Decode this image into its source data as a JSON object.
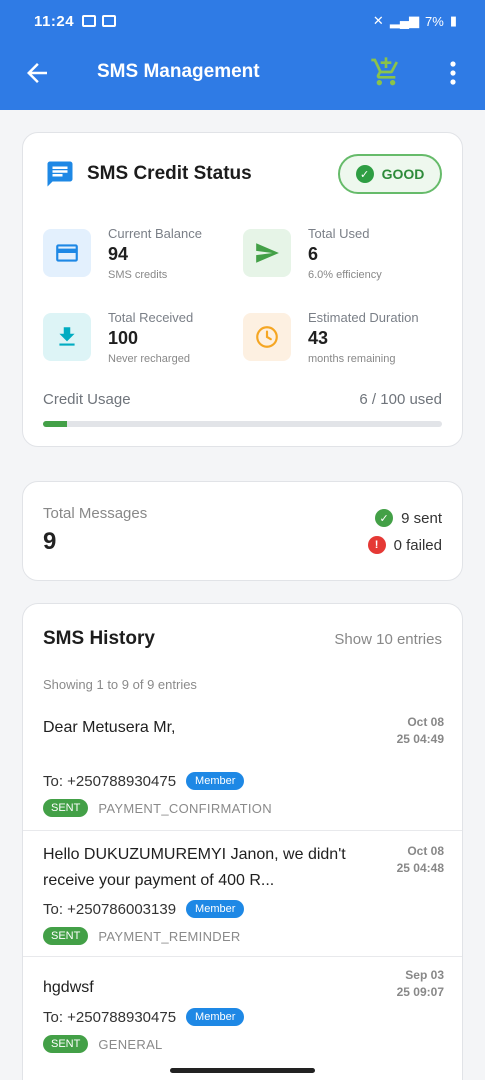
{
  "status_bar": {
    "time": "11:24",
    "battery": "7%"
  },
  "header": {
    "title": "SMS Management"
  },
  "credit": {
    "title": "SMS Credit Status",
    "status": "GOOD",
    "stats": [
      {
        "label": "Current Balance",
        "value": "94",
        "sub": "SMS credits"
      },
      {
        "label": "Total Used",
        "value": "6",
        "sub": "6.0% efficiency"
      },
      {
        "label": "Total Received",
        "value": "100",
        "sub": "Never recharged"
      },
      {
        "label": "Estimated Duration",
        "value": "43",
        "sub": "months remaining"
      }
    ],
    "usage_label": "Credit Usage",
    "usage_value": "6 / 100 used",
    "usage_fraction": 0.06
  },
  "totals": {
    "label": "Total Messages",
    "value": "9",
    "sent": "9 sent",
    "failed": "0 failed"
  },
  "history": {
    "title": "SMS History",
    "show": "Show 10 entries",
    "info": "Showing 1 to 9 of 9 entries",
    "entries": [
      {
        "message": "Dear Metusera Mr,",
        "date_line1": "Oct 08",
        "date_line2": "25 04:49",
        "to": "To: +250788930475",
        "role": "Member",
        "status": "SENT",
        "type": "PAYMENT_CONFIRMATION"
      },
      {
        "message": "Hello DUKUZUMUREMYI Janon, we didn't receive your payment of 400 R...",
        "date_line1": "Oct 08",
        "date_line2": "25 04:48",
        "to": "To: +250786003139",
        "role": "Member",
        "status": "SENT",
        "type": "PAYMENT_REMINDER"
      },
      {
        "message": "hgdwsf",
        "date_line1": "Sep 03",
        "date_line2": "25 09:07",
        "to": "To: +250788930475",
        "role": "Member",
        "status": "SENT",
        "type": "GENERAL"
      }
    ]
  },
  "colors": {
    "appbar": "#2f7be5",
    "good": "#2e8b3a",
    "sent": "#43a047",
    "member": "#1e88e5",
    "failed": "#e53935"
  }
}
